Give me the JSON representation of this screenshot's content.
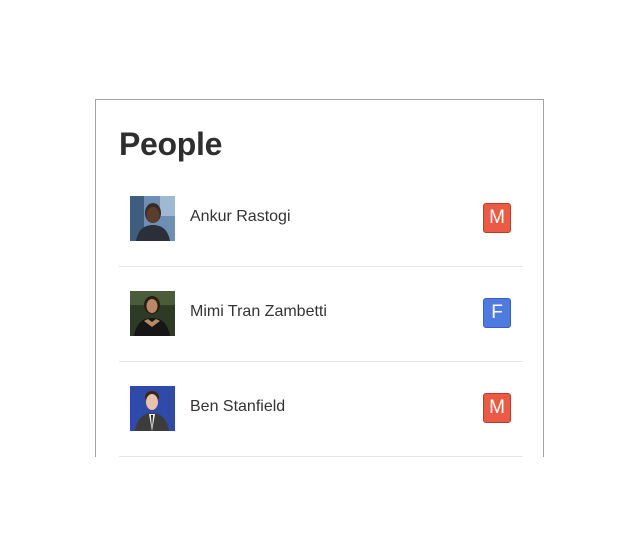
{
  "panel": {
    "title": "People"
  },
  "people": [
    {
      "name": "Ankur Rastogi",
      "gender": "M",
      "badge_color": "#ea5a44",
      "avatar_icon": "avatar-photo-icon"
    },
    {
      "name": "Mimi Tran Zambetti",
      "gender": "F",
      "badge_color": "#4f7be0",
      "avatar_icon": "avatar-photo-icon"
    },
    {
      "name": "Ben Stanfield",
      "gender": "M",
      "badge_color": "#ea5a44",
      "avatar_icon": "avatar-photo-icon"
    }
  ]
}
